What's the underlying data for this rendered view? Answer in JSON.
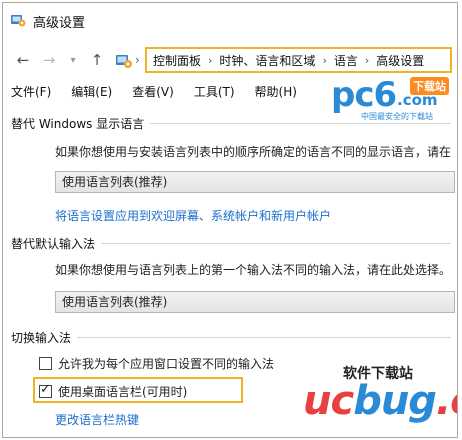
{
  "window": {
    "title": "高级设置"
  },
  "address": {
    "crumbs": [
      "控制面板",
      "时钟、语言和区域",
      "语言",
      "高级设置"
    ],
    "separator": "›"
  },
  "menu": {
    "items": [
      "文件(F)",
      "编辑(E)",
      "查看(V)",
      "工具(T)",
      "帮助(H)"
    ]
  },
  "watermark_pc6": {
    "logo_main": "pc6",
    "logo_com": ".com",
    "download_badge": "下载站",
    "subtitle": "中国最安全的下载站"
  },
  "display_language": {
    "header": "替代 Windows 显示语言",
    "description": "如果你想使用与安装语言列表中的顺序所确定的语言不同的显示语言，请在",
    "select_value": "使用语言列表(推荐)",
    "link": "将语言设置应用到欢迎屏幕、系统帐户和新用户帐户"
  },
  "default_input": {
    "header": "替代默认输入法",
    "description": "如果你想使用与语言列表上的第一个输入法不同的输入法，请在此处选择。",
    "select_value": "使用语言列表(推荐)"
  },
  "switch_input": {
    "header": "切换输入法",
    "option1_label": "允许我为每个应用窗口设置不同的输入法",
    "option1_checked": false,
    "option2_label": "使用桌面语言栏(可用时)",
    "option2_checked": true,
    "link": "更改语言栏热键"
  },
  "watermark_ucbug": {
    "top_text": "软件下载站",
    "main_uc": "uc",
    "main_bug": "bug",
    "main_cc": ".cc"
  },
  "colors": {
    "highlight": "#f0b323",
    "link": "#1a6fcc"
  }
}
